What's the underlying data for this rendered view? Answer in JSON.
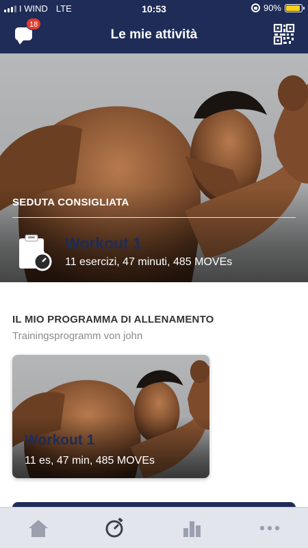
{
  "status_bar": {
    "carrier": "I WIND",
    "network": "LTE",
    "time": "10:53",
    "battery": "90%",
    "battery_level": 0.9
  },
  "header": {
    "title": "Le mie attività",
    "chat_badge_count": "18",
    "colors": {
      "header_bg": "#1f2c57",
      "badge": "#e33b2e"
    }
  },
  "recommended": {
    "section_label": "SEDUTA CONSIGLIATA",
    "workout_title": "Workout 1",
    "workout_meta": "11 esercizi, 47 minuti, 485 MOVEs"
  },
  "program": {
    "section_label": "IL MIO PROGRAMMA DI ALLENAMENTO",
    "subtitle": "Trainingsprogramm von john",
    "cards": [
      {
        "title": "Workout 1",
        "meta": "11 es, 47 min, 485 MOVEs"
      }
    ]
  },
  "tab_bar": {
    "items": [
      {
        "icon": "home-icon",
        "active": false
      },
      {
        "icon": "stopwatch-icon",
        "active": true
      },
      {
        "icon": "bar-chart-icon",
        "active": false
      },
      {
        "icon": "more-dots-icon",
        "active": false
      }
    ]
  }
}
